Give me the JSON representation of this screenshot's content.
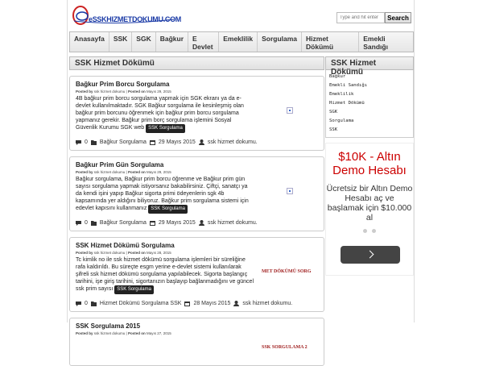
{
  "header": {
    "logo_text": "eSSKHIZMETDOKUMU.COM",
    "search_placeholder": "Type and hit enter",
    "search_button": "Search"
  },
  "nav": {
    "items": [
      "Anasayfa",
      "SSK",
      "SGK",
      "Bağkur",
      "E Devlet",
      "Emeklilik",
      "Sorgulama",
      "Hizmet Dökümü",
      "Emekli Sandığı"
    ]
  },
  "main": {
    "title": "SSK Hizmet Dökümü",
    "posts": [
      {
        "title": "Bağkur Prim Borcu Sorgulama",
        "posted_by_label": "Posted by",
        "author": "ssk hizmet dokumu",
        "posted_on_label": "Posted on",
        "date": "Mayıs 29, 2015",
        "excerpt": "4B bağkur prim borcu sorgulama yapmak için SGK ekranı ya da e-devlet kullanılmaktadır. SGK Bağkur sorgulama ile kesinleşmiş olan bağkur prim borcunu öğrenmek için bağkur prim borcu sorgulama yapmanız gerekir. Bağkur prim borç sorgulama işlemini Sosyal Güvenlik Kurumu SGK web",
        "tag": "SSK Sorgulama",
        "comments": "0",
        "category": "Bağkur Sorgulama",
        "footer_date": "29 Mayıs 2015",
        "footer_author": "ssk hizmet dokumu.",
        "thumb_text": ""
      },
      {
        "title": "Bağkur Prim Gün Sorgulama",
        "posted_by_label": "Posted by",
        "author": "ssk hizmet dokumu",
        "posted_on_label": "Posted on",
        "date": "Mayıs 29, 2015",
        "excerpt": "Bağkur sorgulama, Bağkur prim borcu öğrenme ve Bağkur prim gün sayısı sorgulama yapmak istiyorsanız bakabilirsiniz. Çiftçi, sanatçı ya da kendi işini yapıp Bağkur sigorta primi ödeyenlerin sgk 4b kapsamında yer aldığını biliyoruz. Bağkur prim sorgulama sistemi için edevlet kapısını kullanmanız",
        "tag": "SSK Sorgulama",
        "comments": "0",
        "category": "Bağkur Sorgulama",
        "footer_date": "29 Mayıs 2015",
        "footer_author": "ssk hizmet dokumu.",
        "thumb_text": ""
      },
      {
        "title": "SSK Hizmet Dökümü Sorgulama",
        "posted_by_label": "Posted by",
        "author": "ssk hizmet dokumu",
        "posted_on_label": "Posted on",
        "date": "Mayıs 28, 2015",
        "excerpt": "Tc kimlik no ile ssk hizmet dökümü sorgulama işlemleri bir süreliğine rafa kaldırıldı. Bu süreçte esgm yerine e-devlet sistemi kullanılarak şifreli ssk hizmet dökümü sorgulama yapılabilecek. Sigorta başlangıç tarihini, işe giriş tarihini, sigortanızın başlayıp bağlanmadığını ve güncel ssk prim sayısı",
        "tag": "SSK Sorgulama",
        "comments": "0",
        "category": "Hizmet Dökümü Sorgulama SSK",
        "footer_date": "28 Mayıs 2015",
        "footer_author": "ssk hizmet dokumu.",
        "thumb_text": "MET DÖKÜMÜ SORG"
      },
      {
        "title": "SSK Sorgulama 2015",
        "posted_by_label": "Posted by",
        "author": "ssk hizmet dokumu",
        "posted_on_label": "Posted on",
        "date": "Mayıs 27, 2015",
        "excerpt": "",
        "tag": "",
        "comments": "",
        "category": "",
        "footer_date": "",
        "footer_author": "",
        "thumb_text": "SSK SORGULAMA 2"
      }
    ]
  },
  "sidebar": {
    "title": "SSK Hizmet Dökümü",
    "items": [
      "Bağkur",
      "Emekli Sandığı",
      "Emeklilik",
      "Hizmet Dökümü",
      "SGK",
      "Sorgulama",
      "SSK"
    ],
    "ad": {
      "headline": "$10K - Altın Demo Hesabı",
      "body": "Ücretsiz bir Altın Demo Hesabı aç ve başlamak için $10.000 al"
    }
  },
  "colors": {
    "brand_blue": "#1a3aa6",
    "ad_red": "#cc0000",
    "tag_bg": "#222222"
  }
}
